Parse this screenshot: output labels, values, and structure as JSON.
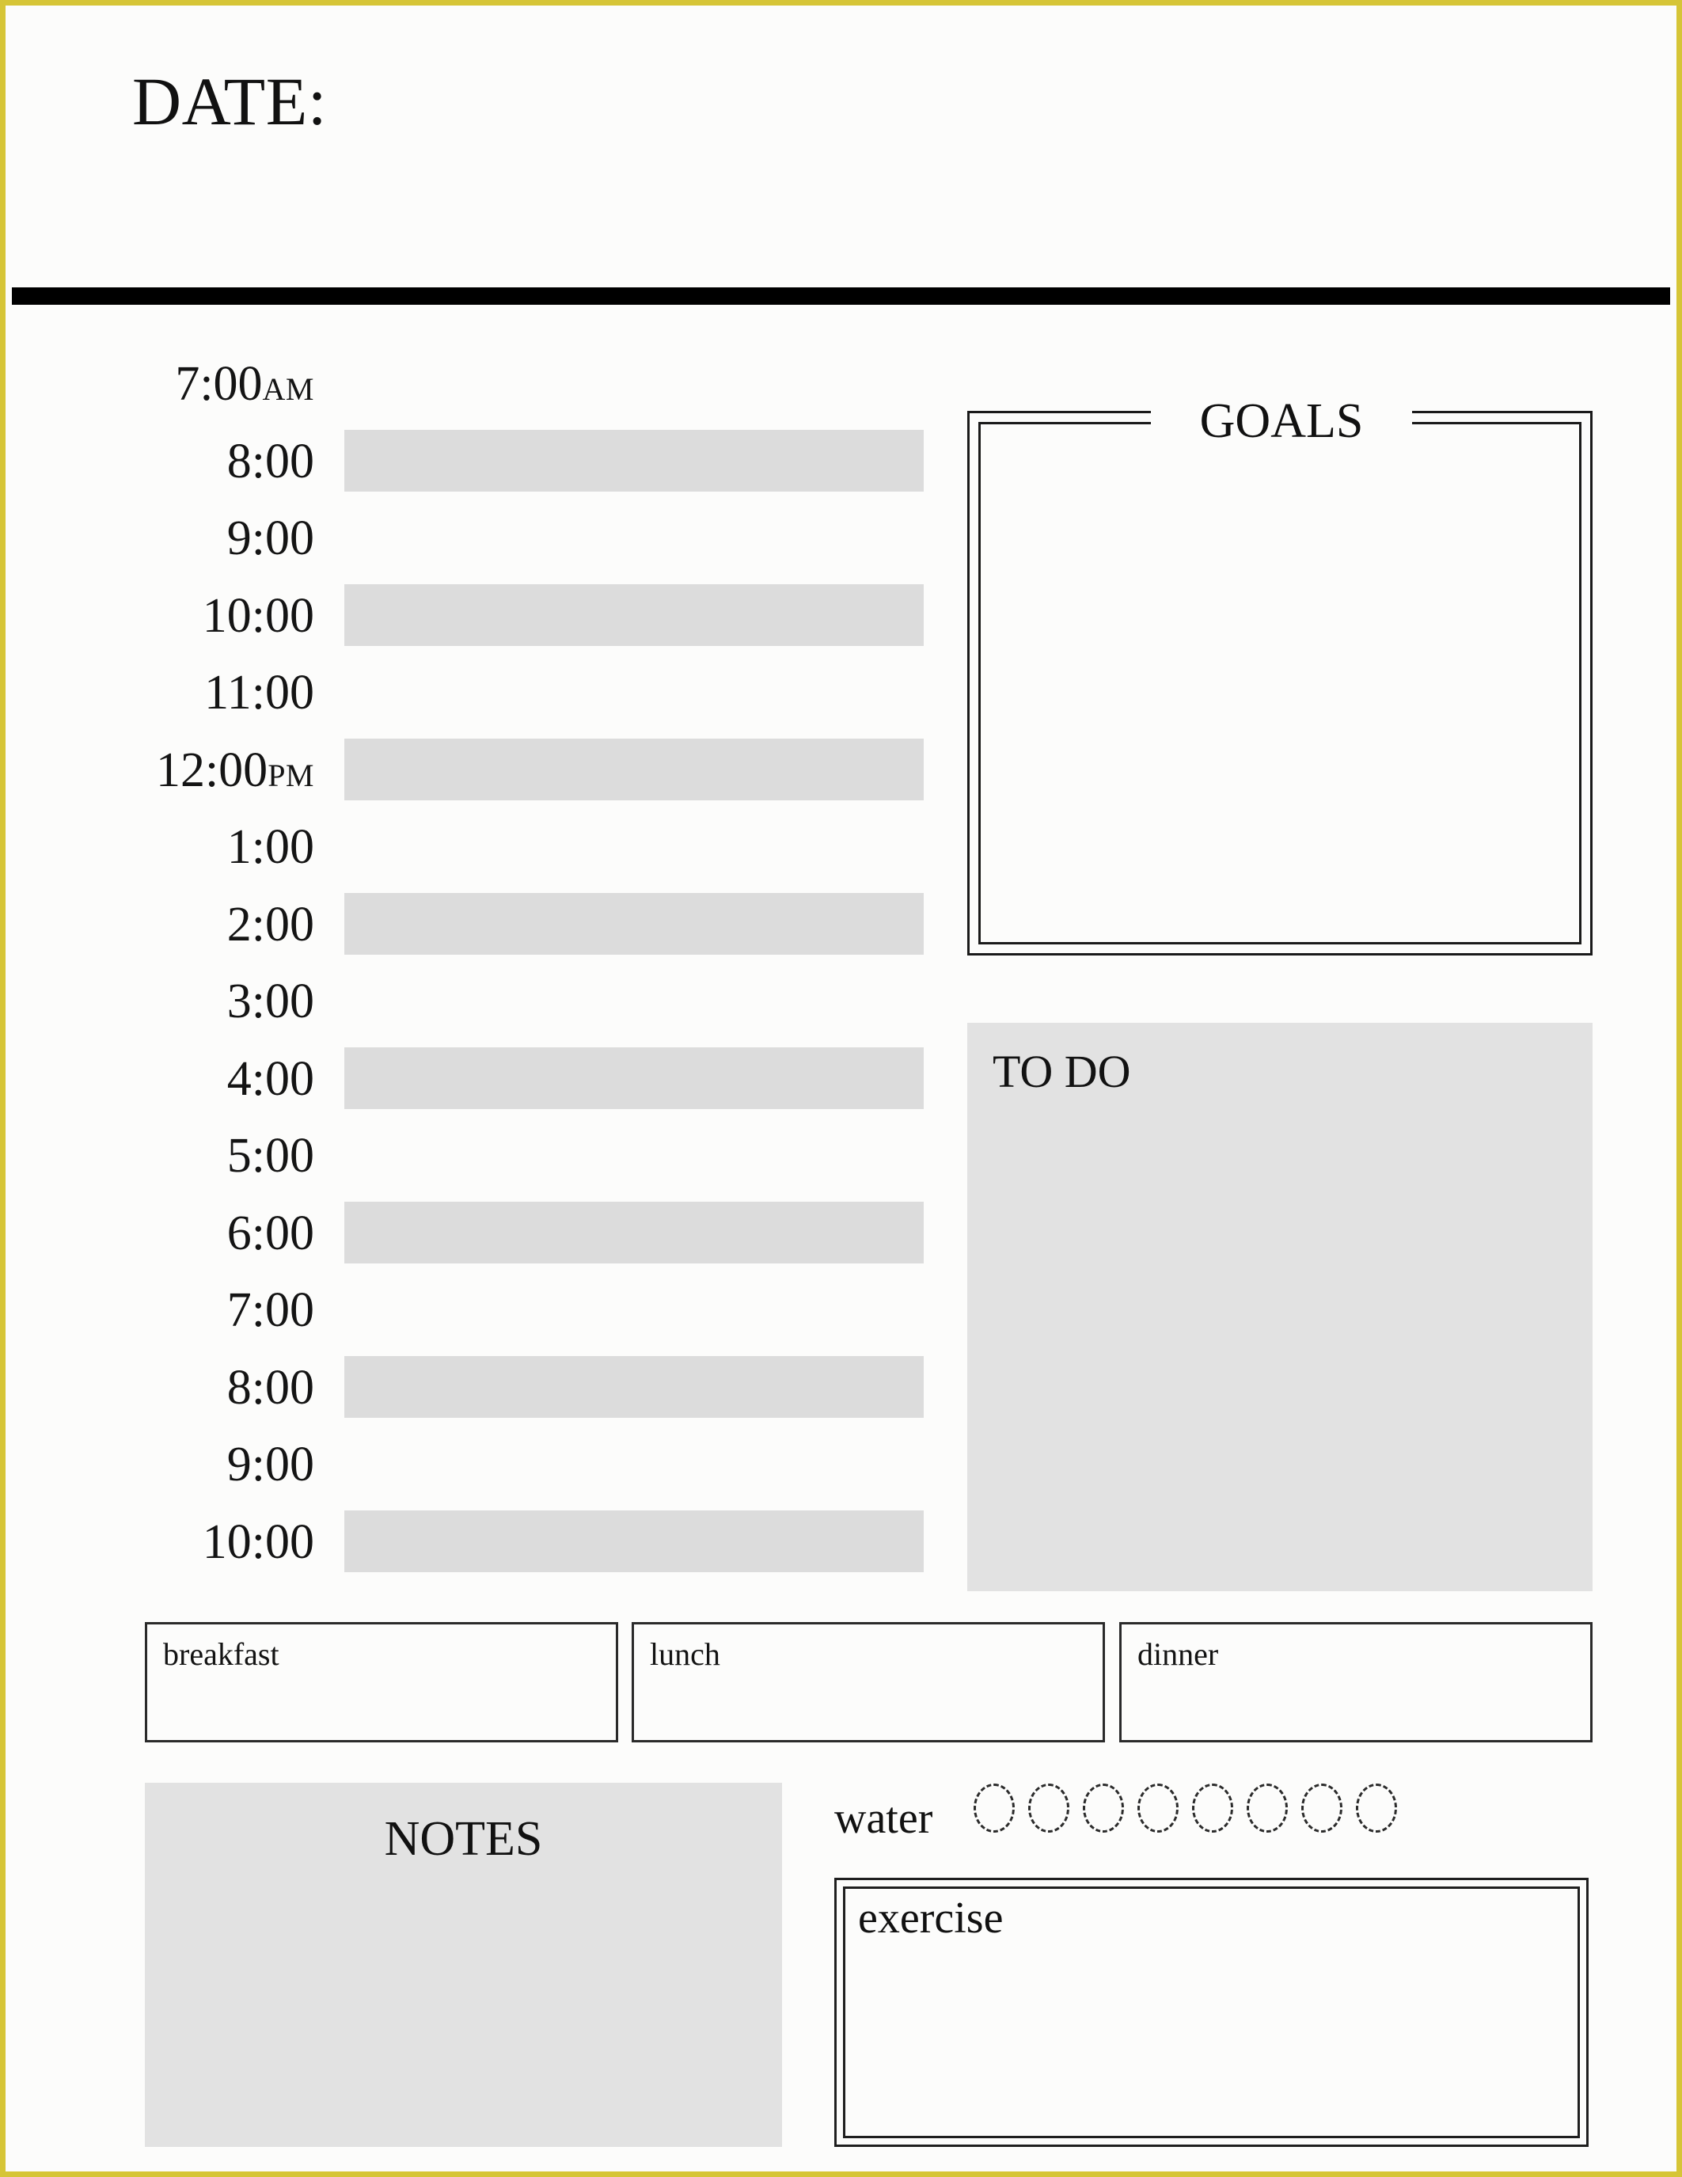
{
  "page": {
    "border_color": "#d6c537",
    "background": "#fcfcfb",
    "accent_bar_color": "#000000",
    "fill_gray": "#dcdcdc",
    "panel_gray": "#e2e2e2"
  },
  "header": {
    "date_label": "DATE:"
  },
  "schedule": {
    "rows": [
      {
        "time": "7:00",
        "meridiem": "AM",
        "filled": false
      },
      {
        "time": "8:00",
        "meridiem": "",
        "filled": true
      },
      {
        "time": "9:00",
        "meridiem": "",
        "filled": false
      },
      {
        "time": "10:00",
        "meridiem": "",
        "filled": true
      },
      {
        "time": "11:00",
        "meridiem": "",
        "filled": false
      },
      {
        "time": "12:00",
        "meridiem": "PM",
        "filled": true
      },
      {
        "time": "1:00",
        "meridiem": "",
        "filled": false
      },
      {
        "time": "2:00",
        "meridiem": "",
        "filled": true
      },
      {
        "time": "3:00",
        "meridiem": "",
        "filled": false
      },
      {
        "time": "4:00",
        "meridiem": "",
        "filled": true
      },
      {
        "time": "5:00",
        "meridiem": "",
        "filled": false
      },
      {
        "time": "6:00",
        "meridiem": "",
        "filled": true
      },
      {
        "time": "7:00",
        "meridiem": "",
        "filled": false
      },
      {
        "time": "8:00",
        "meridiem": "",
        "filled": true
      },
      {
        "time": "9:00",
        "meridiem": "",
        "filled": false
      },
      {
        "time": "10:00",
        "meridiem": "",
        "filled": true
      }
    ]
  },
  "goals": {
    "title": "GOALS",
    "content": ""
  },
  "todo": {
    "title": "TO DO",
    "content": ""
  },
  "meals": [
    {
      "label": "breakfast",
      "value": ""
    },
    {
      "label": "lunch",
      "value": ""
    },
    {
      "label": "dinner",
      "value": ""
    }
  ],
  "notes": {
    "title": "NOTES",
    "content": ""
  },
  "water": {
    "label": "water",
    "count": 8,
    "filled": 0
  },
  "exercise": {
    "label": "exercise",
    "content": ""
  },
  "watermark": {
    "text": ""
  }
}
